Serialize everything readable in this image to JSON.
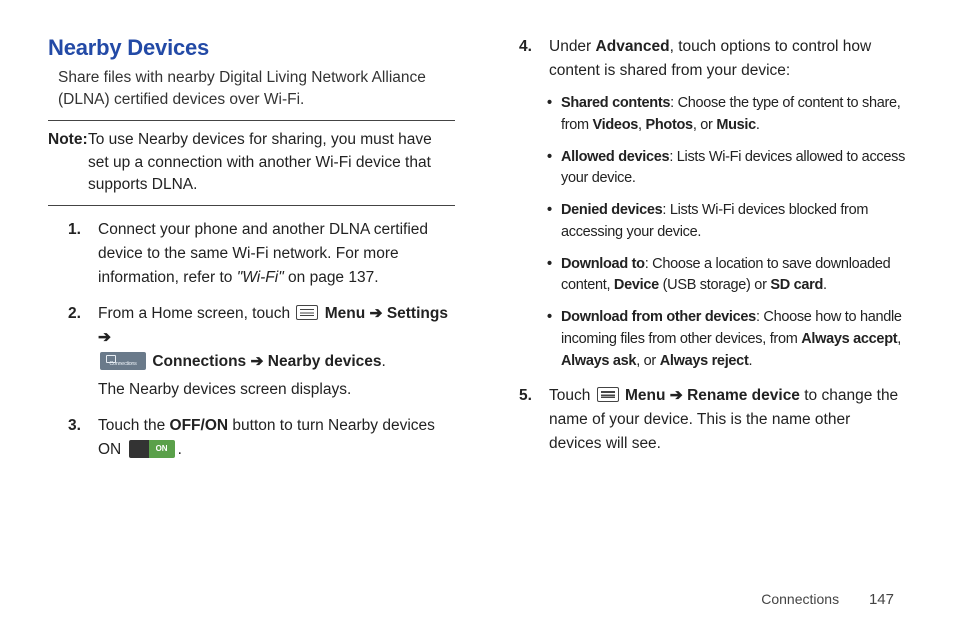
{
  "title": "Nearby Devices",
  "intro": "Share files with nearby Digital Living Network Alliance (DLNA) certified devices over Wi-Fi.",
  "note": {
    "label": "Note:",
    "text": "To use Nearby devices for sharing, you must have set up a connection with another Wi-Fi device that supports DLNA."
  },
  "step1": {
    "pre": "Connect your phone and another DLNA certified device to the same Wi-Fi network. For more information, refer to ",
    "link": "\"Wi-Fi\"",
    "post": " on page 137."
  },
  "step2": {
    "pre": "From a Home screen, touch ",
    "menu": "Menu",
    "arrow": " ➔ ",
    "settings": "Settings",
    "connections": "Connections",
    "nearby": "Nearby devices",
    "sub": "The Nearby devices screen displays."
  },
  "step3": {
    "pre": "Touch the ",
    "btn": "OFF/ON",
    "mid": " button to turn Nearby devices ON ",
    "onlabel": "ON",
    "end": "."
  },
  "step4": {
    "intro_pre": "Under ",
    "advanced": "Advanced",
    "intro_post": ", touch options to control how content is shared from your device:"
  },
  "b1": {
    "t": "Shared contents",
    "d1": ": Choose the type of content to share, from ",
    "w1": "Videos",
    "c1": ", ",
    "w2": "Photos",
    "c2": ", or ",
    "w3": "Music",
    "end": "."
  },
  "b2": {
    "t": "Allowed devices",
    "d": ": Lists Wi-Fi devices allowed to access your device."
  },
  "b3": {
    "t": "Denied devices",
    "d": ": Lists Wi-Fi devices blocked from accessing your device."
  },
  "b4": {
    "t": "Download to",
    "d1": ": Choose a location to save downloaded content, ",
    "w1": "Device",
    "d2": " (USB storage) or ",
    "w2": "SD card",
    "end": "."
  },
  "b5": {
    "t": "Download from other devices",
    "d1": ": Choose how to handle incoming files from other devices, from ",
    "w1": "Always accept",
    "c1": ", ",
    "w2": "Always ask",
    "c2": ", or ",
    "w3": "Always reject",
    "end": "."
  },
  "step5": {
    "pre": "Touch ",
    "menu": "Menu",
    "arrow": " ➔ ",
    "rename": "Rename device",
    "post": " to change the name of your device. This is the name other devices will see."
  },
  "footer": {
    "section": "Connections",
    "page": "147"
  }
}
